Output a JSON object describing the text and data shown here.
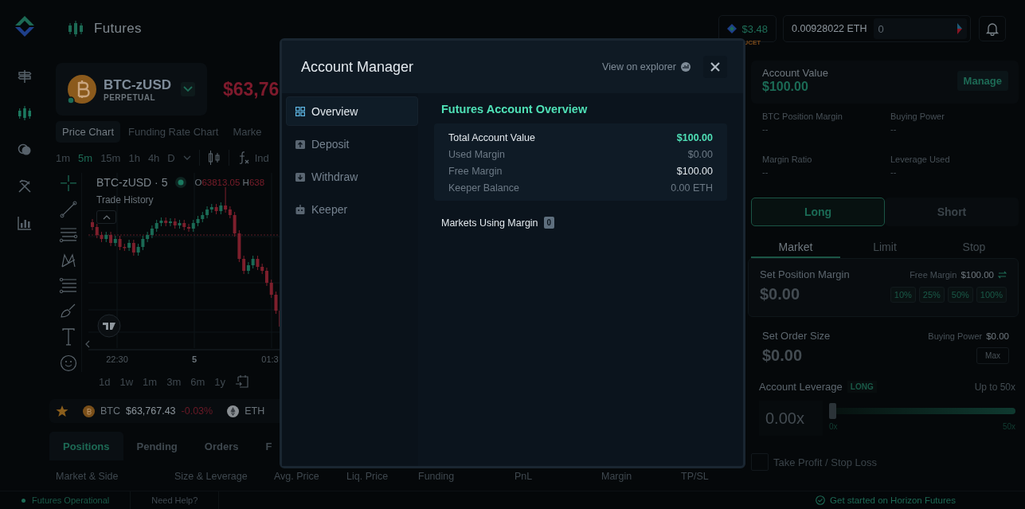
{
  "header": {
    "title": "Futures"
  },
  "rail": [
    {
      "kind": "signpost",
      "selected": false
    },
    {
      "kind": "candles",
      "selected": true
    },
    {
      "kind": "coins",
      "selected": false
    },
    {
      "kind": "tools",
      "selected": false
    },
    {
      "kind": "bars",
      "selected": false
    }
  ],
  "wallet": {
    "faucet_amount": "$3.48",
    "faucet_label": "UCET",
    "eth_balance": "0.00928022 ETH",
    "field_value": "0"
  },
  "market": {
    "symbol": "BTC-zUSD",
    "type": "PERPETUAL",
    "price": "$63,76"
  },
  "chart_tabs": [
    {
      "label": "Price Chart",
      "selected": true
    },
    {
      "label": "Funding Rate Chart",
      "selected": false
    },
    {
      "label": "Marke",
      "selected": false
    }
  ],
  "intervals": [
    {
      "label": "1m",
      "selected": false
    },
    {
      "label": "5m",
      "selected": true
    },
    {
      "label": "15m",
      "selected": false
    },
    {
      "label": "1h",
      "selected": false
    },
    {
      "label": "4h",
      "selected": false
    },
    {
      "label": "D",
      "selected": false
    }
  ],
  "indicators_label": "Ind",
  "legend": {
    "symbol": "BTC-zUSD · 5",
    "open_label": "O",
    "open": "63813.05",
    "high_label": "H",
    "high": "638",
    "trade_history": "Trade History"
  },
  "time_labels": [
    "22:30",
    "5",
    "01:3"
  ],
  "ranges": [
    "1d",
    "1w",
    "1m",
    "3m",
    "6m",
    "1y"
  ],
  "tickers": [
    {
      "kind": "btc",
      "symbol": "BTC",
      "price": "$63,767.43",
      "change": "-0.03%"
    },
    {
      "kind": "eth",
      "symbol": "ETH"
    }
  ],
  "position_tabs": [
    {
      "label": "Positions",
      "selected": true
    },
    {
      "label": "Pending",
      "selected": false
    },
    {
      "label": "Orders",
      "selected": false
    },
    {
      "label": "F",
      "selected": false
    }
  ],
  "position_columns": [
    "Market & Side",
    "Size & Leverage",
    "Avg. Price",
    "Liq. Price",
    "Funding",
    "PnL",
    "Margin",
    "TP/SL"
  ],
  "account": {
    "label": "Account Value",
    "value": "$100.00",
    "button": "Manage"
  },
  "stats": [
    {
      "label": "BTC Position Margin",
      "value": "--"
    },
    {
      "label": "Buying Power",
      "value": "--"
    },
    {
      "label": "Margin Ratio",
      "value": "--"
    },
    {
      "label": "Leverage Used",
      "value": "--"
    }
  ],
  "sides": [
    {
      "label": "Long",
      "selected": true
    },
    {
      "label": "Short",
      "selected": false
    }
  ],
  "order_types": [
    {
      "label": "Market",
      "selected": true
    },
    {
      "label": "Limit",
      "selected": false
    },
    {
      "label": "Stop",
      "selected": false
    }
  ],
  "position_margin": {
    "label": "Set Position Margin",
    "available_label": "Free Margin",
    "available": "$100.00",
    "placeholder": "$0.00",
    "presets": [
      "10%",
      "25%",
      "50%",
      "100%"
    ]
  },
  "order_size": {
    "label": "Set Order Size",
    "available_label": "Buying Power",
    "available": "$0.00",
    "placeholder": "$0.00",
    "button": "Max"
  },
  "leverage": {
    "label": "Account Leverage",
    "side": "LONG",
    "max": "Up to 50x",
    "placeholder": "0.00x",
    "level": 0,
    "min_label": "0x",
    "max_label": "50x"
  },
  "tp_sl": {
    "label": "Take Profit / Stop Loss",
    "checked": false
  },
  "status_bar": {
    "status": "Futures Operational",
    "help": "Need Help?",
    "get_started": "Get started on Horizon Futures"
  },
  "modal": {
    "title": "Account Manager",
    "explorer_link": "View on explorer",
    "nav": [
      {
        "kind": "overview",
        "label": "Overview",
        "selected": true
      },
      {
        "kind": "deposit",
        "label": "Deposit",
        "selected": false
      },
      {
        "kind": "withdraw",
        "label": "Withdraw",
        "selected": false
      },
      {
        "kind": "keeper",
        "label": "Keeper",
        "selected": false
      }
    ],
    "heading": "Futures Account Overview",
    "rows": [
      {
        "kind": "total",
        "label": "Total Account Value",
        "value": "$100.00"
      },
      {
        "kind": "muted",
        "label": "Used Margin",
        "value": "$0.00"
      },
      {
        "kind": "bright",
        "label": "Free Margin",
        "value": "$100.00"
      },
      {
        "kind": "muted",
        "label": "Keeper Balance",
        "value": "0.00 ETH"
      }
    ],
    "markets_label": "Markets Using Margin",
    "markets_count": "0"
  }
}
